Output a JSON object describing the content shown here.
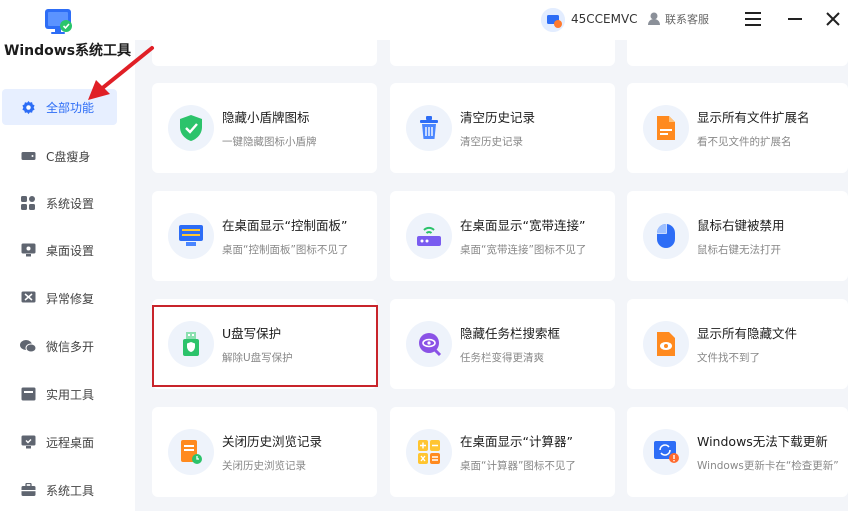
{
  "app": {
    "title": "Windows系统工具"
  },
  "sidebar": {
    "items": [
      {
        "label": "全部功能",
        "icon": "gear-icon",
        "active": true
      },
      {
        "label": "C盘瘦身",
        "icon": "drive-icon"
      },
      {
        "label": "系统设置",
        "icon": "grid-icon"
      },
      {
        "label": "桌面设置",
        "icon": "monitor-icon"
      },
      {
        "label": "异常修复",
        "icon": "wrench-icon"
      },
      {
        "label": "微信多开",
        "icon": "chat-icon"
      },
      {
        "label": "实用工具",
        "icon": "toolbox-icon"
      },
      {
        "label": "远程桌面",
        "icon": "remote-desktop-icon"
      },
      {
        "label": "系统工具",
        "icon": "briefcase-icon"
      }
    ]
  },
  "topbar": {
    "user_name": "45CCEMVC",
    "service_label": "联系客服"
  },
  "cards": [
    {
      "title": "隐藏小盾牌图标",
      "desc": "一键隐藏图标小盾牌",
      "icon": "shield-icon"
    },
    {
      "title": "清空历史记录",
      "desc": "清空历史记录",
      "icon": "trash-icon"
    },
    {
      "title": "显示所有文件扩展名",
      "desc": "看不见文件的扩展名",
      "icon": "file-ext-icon"
    },
    {
      "title": "在桌面显示“控制面板”",
      "desc": "桌面“控制面板”图标不见了",
      "icon": "control-panel-icon"
    },
    {
      "title": "在桌面显示“宽带连接”",
      "desc": "桌面“宽带连接”图标不见了",
      "icon": "router-icon"
    },
    {
      "title": "鼠标右键被禁用",
      "desc": "鼠标右键无法打开",
      "icon": "mouse-icon"
    },
    {
      "title": "U盘写保护",
      "desc": "解除U盘写保护",
      "icon": "usb-shield-icon"
    },
    {
      "title": "隐藏任务栏搜索框",
      "desc": "任务栏变得更清爽",
      "icon": "search-hide-icon"
    },
    {
      "title": "显示所有隐藏文件",
      "desc": "文件找不到了",
      "icon": "eye-file-icon"
    },
    {
      "title": "关闭历史浏览记录",
      "desc": "关闭历史浏览记录",
      "icon": "history-doc-icon"
    },
    {
      "title": "在桌面显示“计算器”",
      "desc": "桌面“计算器”图标不见了",
      "icon": "calculator-icon"
    },
    {
      "title": "Windows无法下载更新",
      "desc": "Windows更新卡在“检查更新”",
      "icon": "update-icon"
    }
  ],
  "colors": {
    "accent": "#2d6df6",
    "highlight": "#c8242b"
  }
}
